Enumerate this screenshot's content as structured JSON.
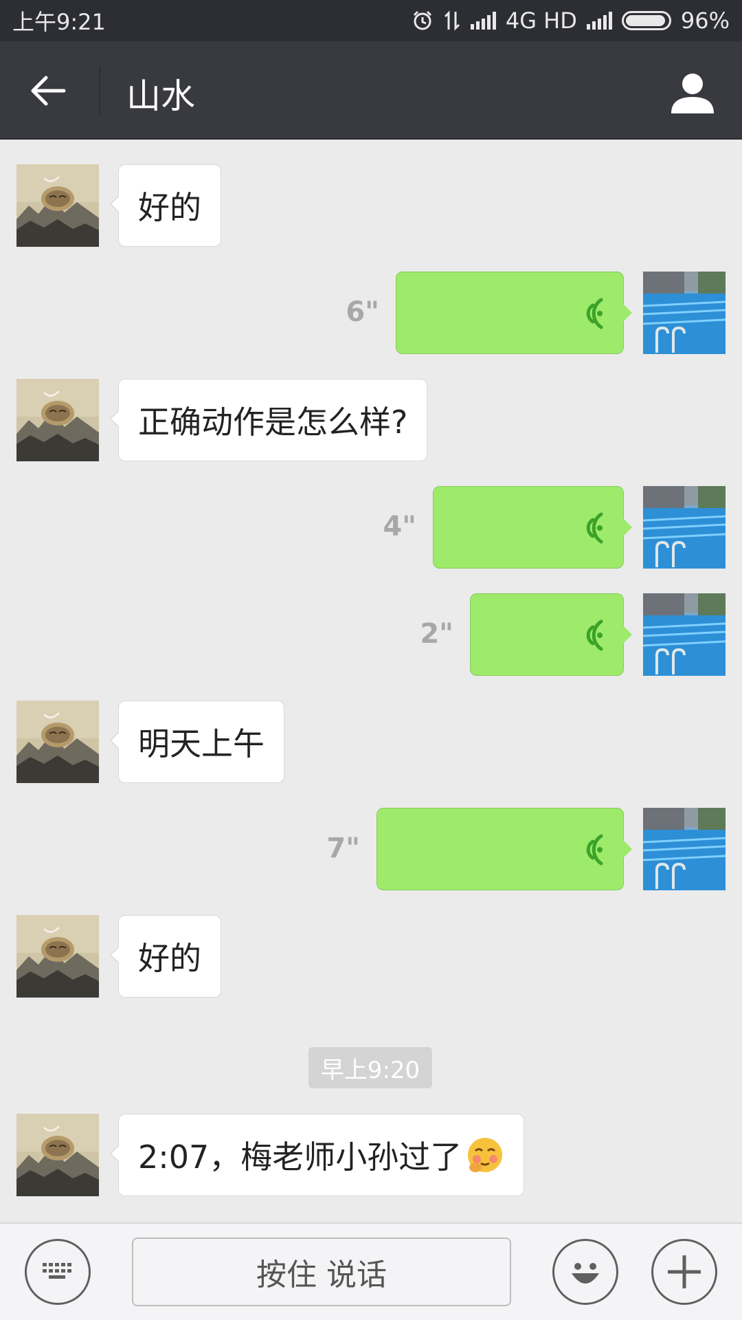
{
  "status_bar": {
    "time": "上午9:21",
    "network": "4G HD",
    "battery": "96%",
    "battery_level": 0.96
  },
  "header": {
    "title": "山水",
    "back_icon": "arrow-left-icon",
    "profile_icon": "person-icon"
  },
  "messages": [
    {
      "side": "left",
      "type": "text",
      "text": "好的"
    },
    {
      "side": "right",
      "type": "voice",
      "duration": "6\""
    },
    {
      "side": "left",
      "type": "text",
      "text": "正确动作是怎么样?"
    },
    {
      "side": "right",
      "type": "voice",
      "duration": "4\""
    },
    {
      "side": "right",
      "type": "voice",
      "duration": "2\""
    },
    {
      "side": "left",
      "type": "text",
      "text": "明天上午"
    },
    {
      "side": "right",
      "type": "voice",
      "duration": "7\""
    },
    {
      "side": "left",
      "type": "text",
      "text": "好的"
    },
    {
      "side": "left",
      "type": "text",
      "text": "2:07，梅老师小孙过了",
      "emoji": "blushing-face-icon"
    }
  ],
  "timestamp": "早上9:20",
  "input_bar": {
    "hold_to_talk": "按住 说话",
    "keyboard_icon": "keyboard-icon",
    "emoji_icon": "smiley-icon",
    "plus_icon": "plus-icon"
  },
  "colors": {
    "header_bg": "#393a3f",
    "chat_bg": "#ebebeb",
    "voice_bubble": "#9eea6a",
    "voice_icon": "#3ba32a"
  }
}
